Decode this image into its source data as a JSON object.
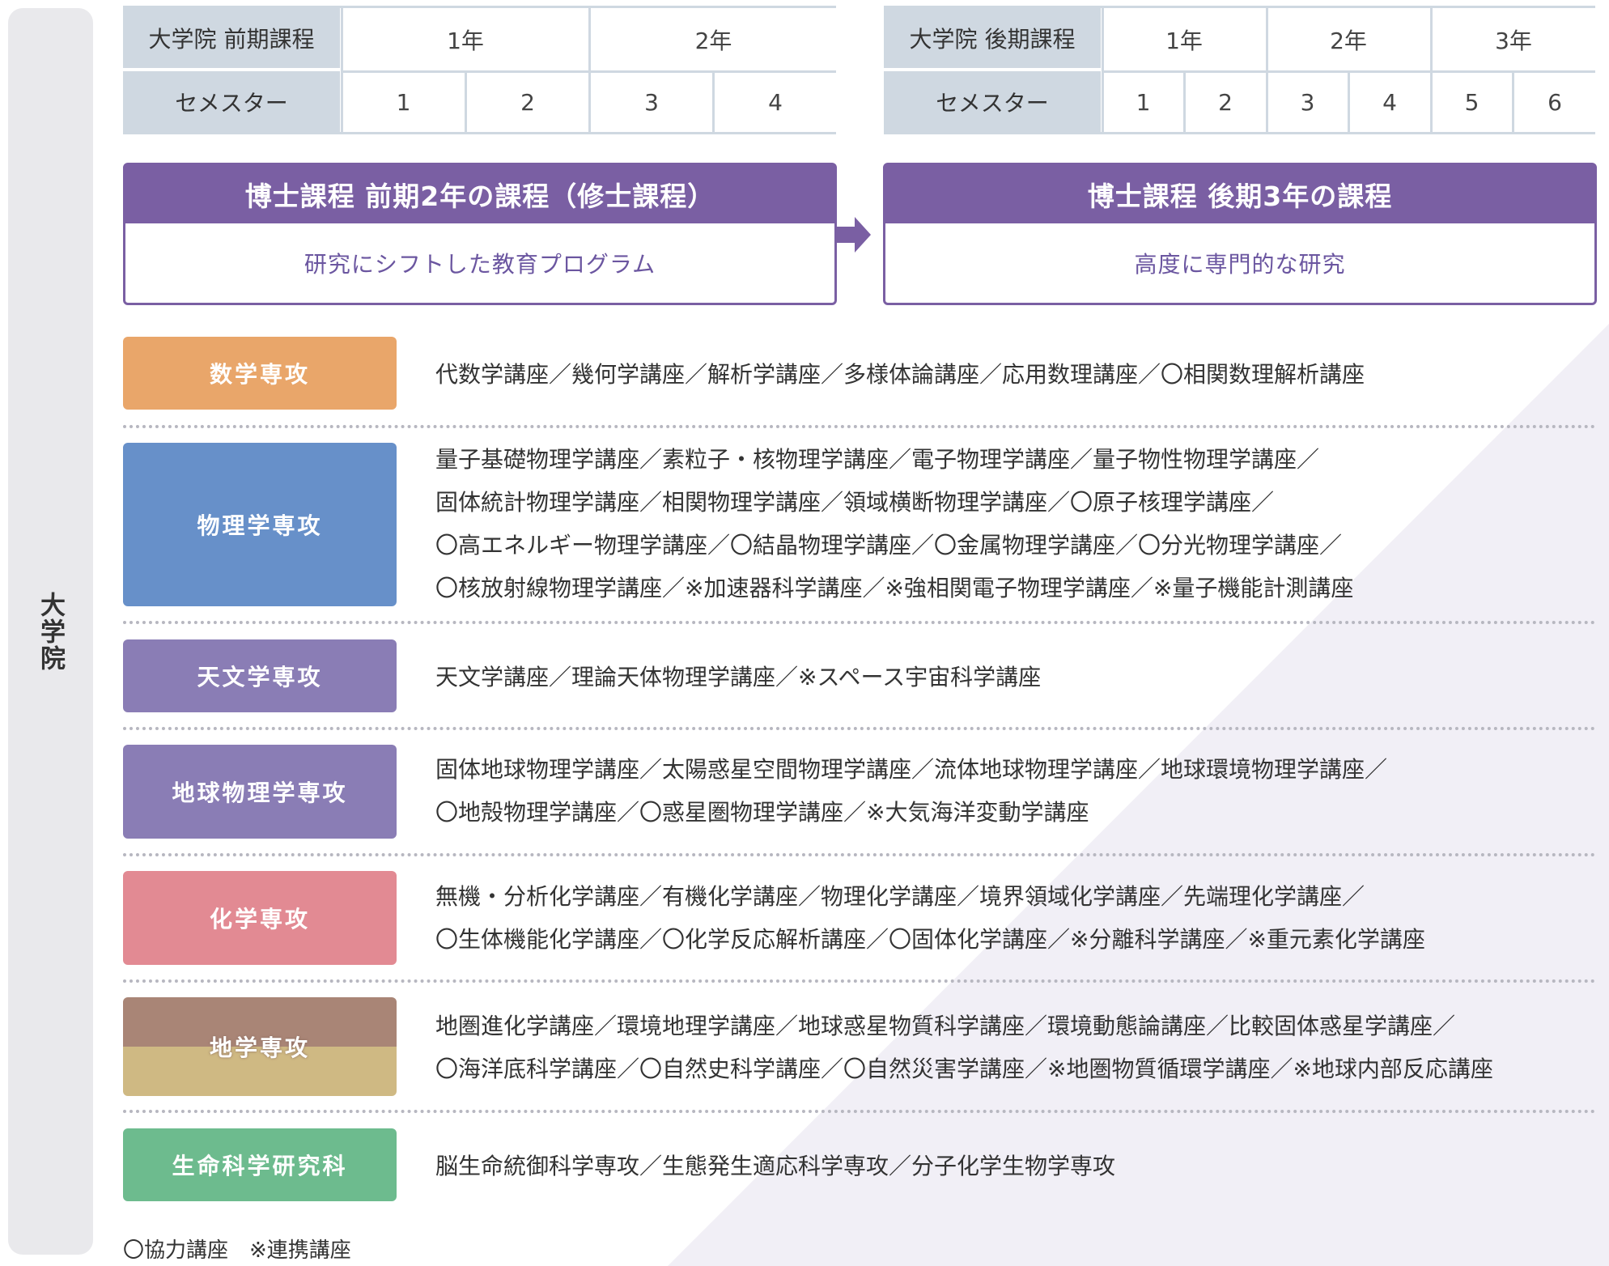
{
  "side_label": "大学院",
  "early": {
    "title": "大学院 前期課程",
    "semester_label": "セメスター",
    "years": [
      "1年",
      "2年"
    ],
    "semesters": [
      "1",
      "2",
      "3",
      "4"
    ]
  },
  "late": {
    "title": "大学院 後期課程",
    "semester_label": "セメスター",
    "years": [
      "1年",
      "2年",
      "3年"
    ],
    "semesters": [
      "1",
      "2",
      "3",
      "4",
      "5",
      "6"
    ]
  },
  "programs": [
    {
      "title": "博士課程 前期2年の課程（修士課程）",
      "subtitle": "研究にシフトした教育プログラム"
    },
    {
      "title": "博士課程 後期3年の課程",
      "subtitle": "高度に専門的な研究"
    }
  ],
  "majors": [
    {
      "name": "数学専攻",
      "color": "#e9a66a",
      "lines": [
        "代数学講座／幾何学講座／解析学講座／多様体論講座／応用数理講座／〇相関数理解析講座"
      ]
    },
    {
      "name": "物理学専攻",
      "color": "#6790c9",
      "lines": [
        "量子基礎物理学講座／素粒子・核物理学講座／電子物理学講座／量子物性物理学講座／",
        "固体統計物理学講座／相関物理学講座／領域横断物理学講座／〇原子核理学講座／",
        "〇高エネルギー物理学講座／〇結晶物理学講座／〇金属物理学講座／〇分光物理学講座／",
        "〇核放射線物理学講座／※加速器科学講座／※強相関電子物理学講座／※量子機能計測講座"
      ]
    },
    {
      "name": "天文学専攻",
      "color": "#8a7db5",
      "lines": [
        "天文学講座／理論天体物理学講座／※スペース宇宙科学講座"
      ]
    },
    {
      "name": "地球物理学専攻",
      "color": "#8a7db5",
      "lines": [
        "固体地球物理学講座／太陽惑星空間物理学講座／流体地球物理学講座／地球環境物理学講座／",
        "〇地殻物理学講座／〇惑星圏物理学講座／※大気海洋変動学講座"
      ]
    },
    {
      "name": "化学専攻",
      "color": "#e28a93",
      "lines": [
        "無機・分析化学講座／有機化学講座／物理化学講座／境界領域化学講座／先端理化学講座／",
        "〇生体機能化学講座／〇化学反応解析講座／〇固体化学講座／※分離科学講座／※重元素化学講座"
      ]
    },
    {
      "name": "地学専攻",
      "color": "#cfb983",
      "lines": [
        "地圏進化学講座／環境地理学講座／地球惑星物質科学講座／環境動態論講座／比較固体惑星学講座／",
        "〇海洋底科学講座／〇自然史科学講座／〇自然災害学講座／※地圏物質循環学講座／※地球内部反応講座"
      ]
    },
    {
      "name": "生命科学研究科",
      "color": "#6dbb8e",
      "lines": [
        "脳生命統御科学専攻／生態発生適応科学専攻／分子化学生物学専攻"
      ]
    }
  ],
  "legend": "〇協力講座　※連携講座",
  "colors": {
    "purple": "#7a5fa3",
    "header_fill": "#cfd8e1",
    "side_fill": "#e9e9ec",
    "triangle_fill": "#f1eff6"
  }
}
